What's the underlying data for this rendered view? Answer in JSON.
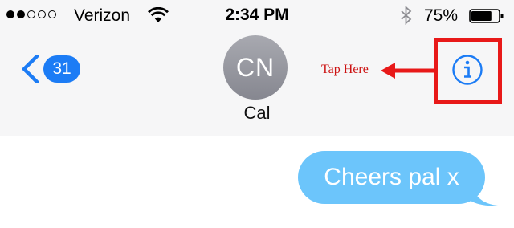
{
  "status_bar": {
    "carrier": "Verizon",
    "time": "2:34 PM",
    "battery_percent": "75%",
    "signal_bars": 2,
    "signal_total": 5,
    "battery_level": 0.75,
    "icons": [
      "signal-dots-icon",
      "wifi-icon",
      "bluetooth-icon",
      "battery-icon"
    ]
  },
  "nav": {
    "back_icon": "chevron-left-icon",
    "unread_count": "31",
    "contact_initials": "CN",
    "contact_name": "Cal",
    "info_icon": "info-icon"
  },
  "annotation": {
    "label": "Tap Here",
    "color": "#e81919"
  },
  "messages": [
    {
      "text": "Cheers pal x",
      "direction": "outgoing",
      "color": "#6cc5fb"
    }
  ],
  "colors": {
    "accent": "#1c7cf5",
    "header_bg": "#f6f6f7"
  }
}
